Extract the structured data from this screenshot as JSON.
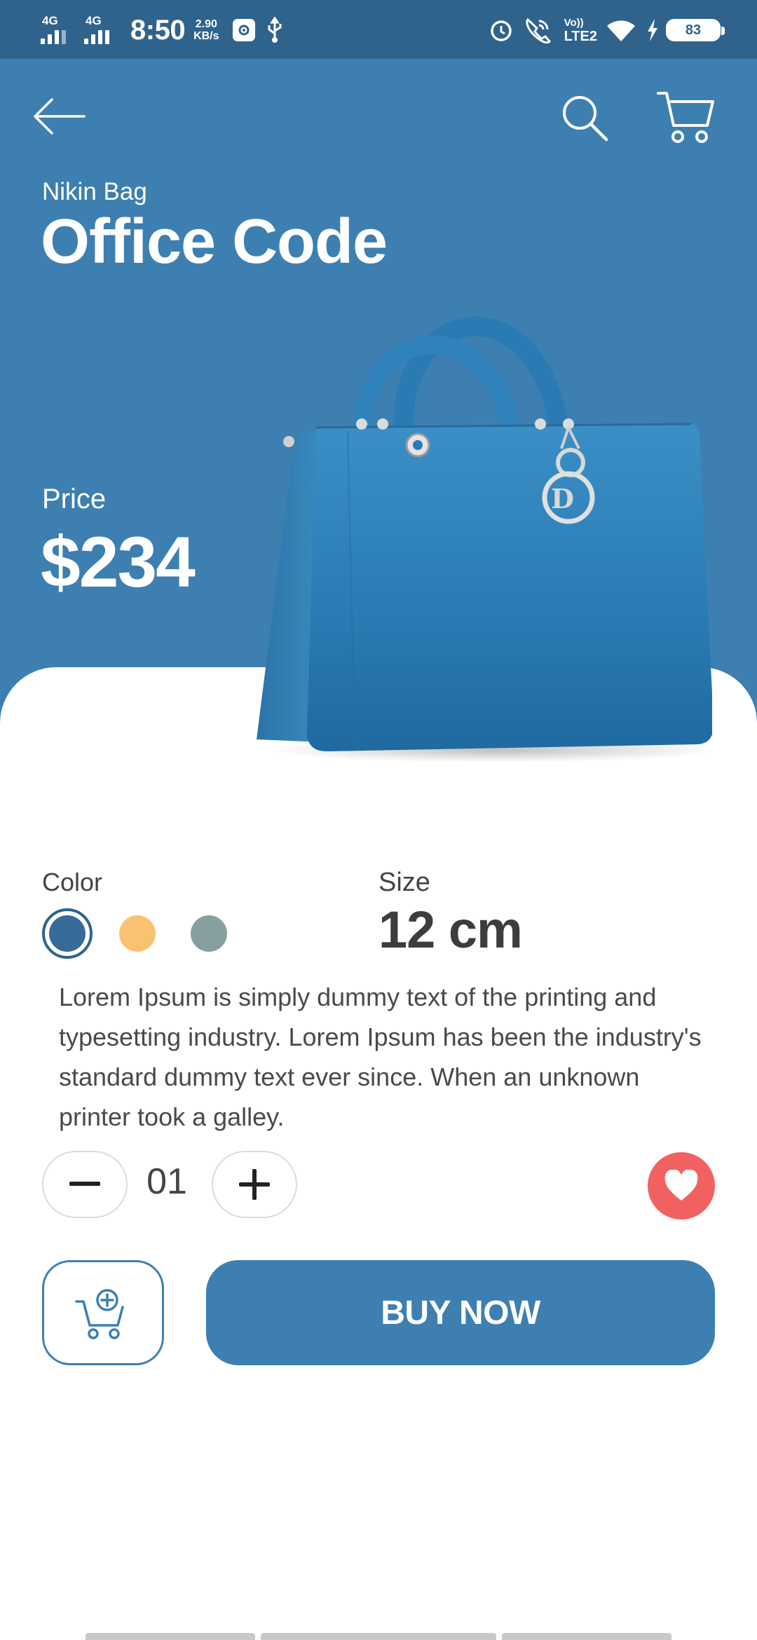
{
  "status_bar": {
    "net1": "4G",
    "net2": "4G",
    "time": "8:50",
    "speed_value": "2.90",
    "speed_unit": "KB/s",
    "volte": "Vo))",
    "lte": "LTE2",
    "battery": "83"
  },
  "header": {
    "back_icon": "arrow-left-icon",
    "search_icon": "search-icon",
    "cart_icon": "cart-icon"
  },
  "product": {
    "brand": "Nikin Bag",
    "name": "Office Code",
    "price_label": "Price",
    "price": "$234",
    "image": "blue-handbag"
  },
  "options": {
    "color_label": "Color",
    "colors": [
      "#386a99",
      "#f9c273",
      "#86a09f"
    ],
    "selected_color": "#386a99",
    "size_label": "Size",
    "size_value": "12 cm"
  },
  "description": "Lorem Ipsum is simply dummy text of the printing and typesetting industry. Lorem Ipsum has been the industry's standard dummy text ever since. When an unknown printer took a galley.",
  "quantity": {
    "value": "01",
    "minus_icon": "minus-icon",
    "plus_icon": "plus-icon"
  },
  "favorite": {
    "icon": "heart-icon",
    "color": "#f26161"
  },
  "actions": {
    "add_to_cart_icon": "cart-add-icon",
    "buy_label": "BUY NOW"
  },
  "theme": {
    "primary": "#3d7fb1",
    "status_bar": "#2f638c"
  }
}
